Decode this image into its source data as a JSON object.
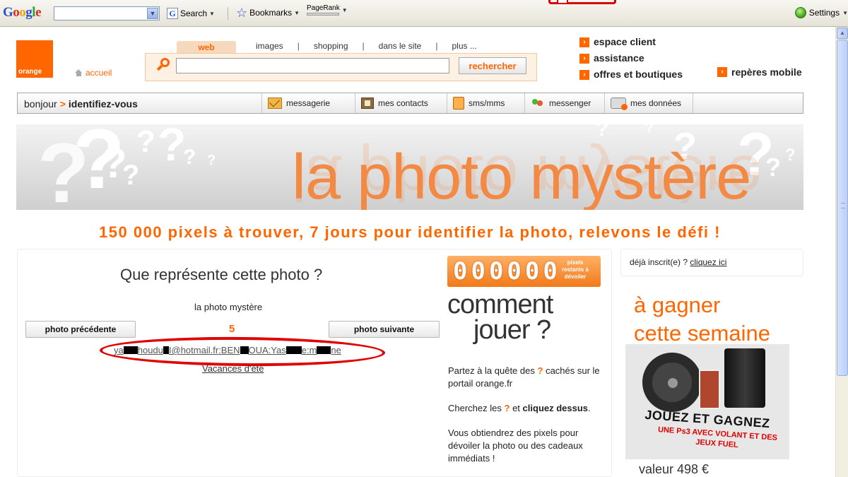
{
  "toolbar": {
    "google_logo": "Google",
    "search_label": "Search",
    "bookmarks_label": "Bookmarks",
    "pagerank_label": "PageRank",
    "settings_label": "Settings"
  },
  "header": {
    "logo_text": "orange",
    "home_link": "accueil",
    "search_tabs": [
      "web",
      "images",
      "shopping",
      "dans le site",
      "plus ..."
    ],
    "search_tab_separator": "|",
    "search_button": "rechercher",
    "search_value": "",
    "right_links": [
      "espace client",
      "assistance",
      "offres et boutiques"
    ],
    "mobile_link": "repères mobile"
  },
  "nav": {
    "greeting": "bonjour",
    "chevron": ">",
    "login": "identifiez-vous",
    "items": [
      "messagerie",
      "mes contacts",
      "sms/mms",
      "messenger",
      "mes données"
    ]
  },
  "banner": {
    "title": "la photo mystère",
    "tagline": "150 000 pixels à trouver, 7 jours pour identifier la photo, relevons le défi !"
  },
  "game": {
    "question": "Que représente cette photo ?",
    "photo_caption": "la photo mystère",
    "prev_button": "photo précédente",
    "next_button": "photo suivante",
    "photo_number": "5",
    "vacation_link": "Vacances d'été"
  },
  "counter": {
    "digits": "000000",
    "label": "pixels restants à dévoiler"
  },
  "howto": {
    "title_line1": "comment",
    "title_line2": "jouer ?",
    "p1_a": "Partez à la quête des",
    "p1_q": "?",
    "p1_b": "cachés sur le portail orange.fr",
    "p2_a": "Cherchez les",
    "p2_q": "?",
    "p2_b": "et",
    "p2_c": "cliquez dessus",
    "p2_d": ".",
    "p3": "Vous obtiendrez des pixels pour dévoiler la photo ou des cadeaux immédiats !"
  },
  "sidebar": {
    "registered_text": "déjà inscrit(e) ?",
    "registered_link": "cliquez ici",
    "win_line1": "à gagner",
    "win_line2": "cette semaine",
    "promo_title": "JOUEZ ET GAGNEZ",
    "promo_sub": "UNE Ps3 AVEC VOLANT ET DES JEUX FUEL",
    "value": "valeur 498 €"
  },
  "colors": {
    "brand_orange": "#ff6600",
    "annotation_red": "#e00000"
  }
}
